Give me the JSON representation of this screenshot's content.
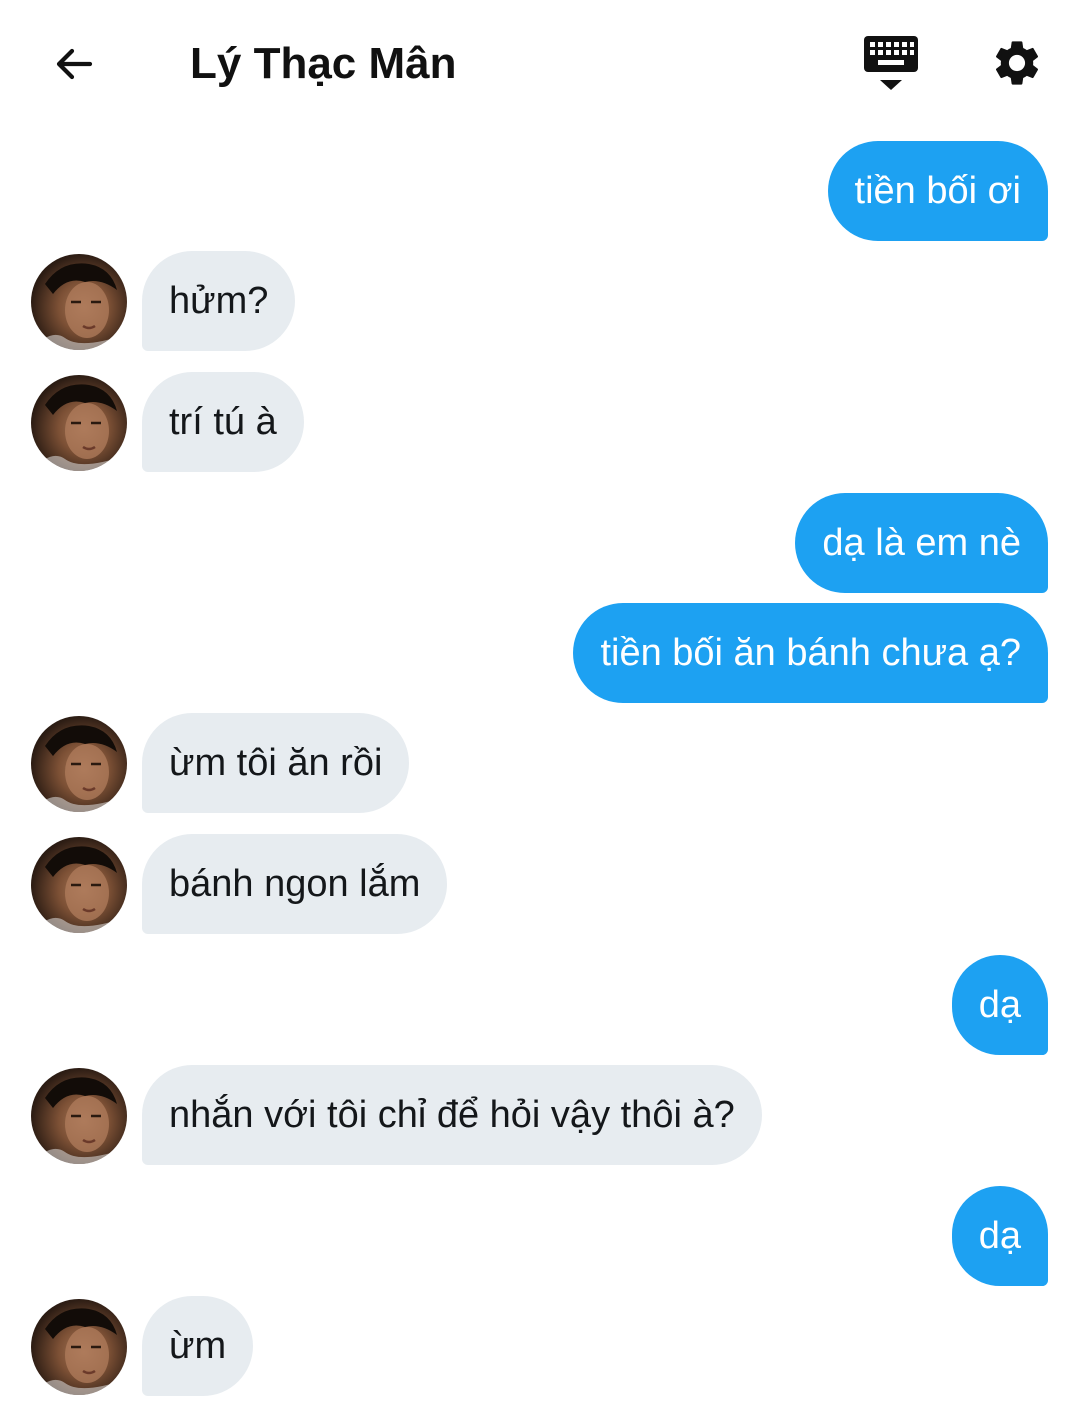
{
  "header": {
    "title": "Lý Thạc Mân",
    "back_icon": "arrow-left-icon",
    "keyboard_icon": "keyboard-hide-icon",
    "settings_icon": "gear-icon"
  },
  "colors": {
    "sent_bubble": "#1da1f2",
    "received_bubble": "#e7ecf0",
    "sent_text": "#ffffff",
    "received_text": "#14171a"
  },
  "messages": [
    {
      "side": "sent",
      "text": "tiền bối ơi"
    },
    {
      "side": "received",
      "text": "hửm?"
    },
    {
      "side": "received",
      "text": "trí tú à"
    },
    {
      "side": "sent",
      "text": "dạ là em nè"
    },
    {
      "side": "sent",
      "text": "tiền bối ăn bánh chưa ạ?"
    },
    {
      "side": "received",
      "text": "ừm tôi ăn rồi"
    },
    {
      "side": "received",
      "text": "bánh ngon lắm"
    },
    {
      "side": "sent",
      "text": "dạ"
    },
    {
      "side": "received",
      "text": "nhắn với tôi chỉ để hỏi vậy thôi à?"
    },
    {
      "side": "sent",
      "text": "dạ"
    },
    {
      "side": "received",
      "text": "ừm"
    }
  ]
}
